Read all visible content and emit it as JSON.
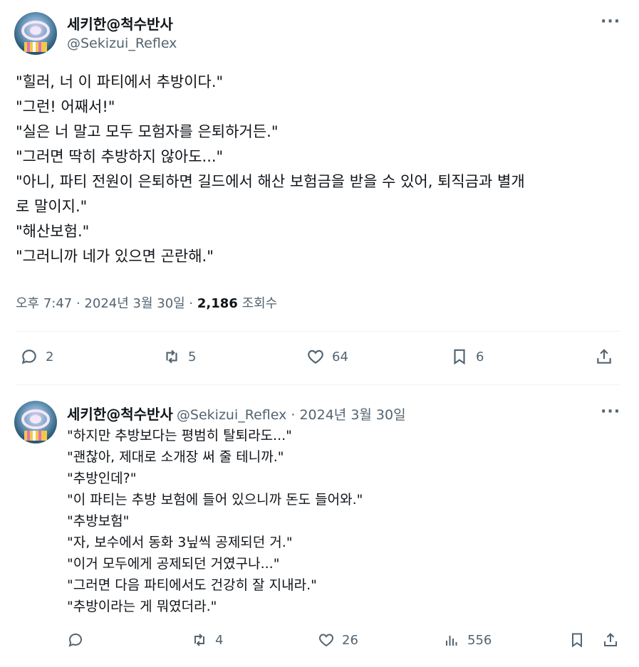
{
  "main_tweet": {
    "display_name": "세키한@척수반사",
    "handle": "@Sekizui_Reflex",
    "lines": [
      "\"힐러, 너 이 파티에서 추방이다.\"",
      "\"그런! 어째서!\"",
      "\"실은 너 말고 모두 모험자를 은퇴하거든.\"",
      "\"그러면 딱히 추방하지 않아도...\"",
      "\"아니, 파티 전원이 은퇴하면 길드에서 해산 보험금을 받을 수 있어, 퇴직금과 별개",
      "로 말이지.\"",
      "\"해산보험.\"",
      "\"그러니까 네가 있으면 곤란해.\""
    ],
    "time": "오후 7:47 · 2024년 3월 30일 · ",
    "views_count": "2,186",
    "views_label": "조회수",
    "actions": {
      "reply_count": "2",
      "retweet_count": "5",
      "like_count": "64",
      "bookmark_count": "6"
    }
  },
  "reply_tweet": {
    "display_name": "세키한@척수반사",
    "handle_date": "@Sekizui_Reflex · 2024년 3월 30일",
    "lines": [
      "\"하지만 추방보다는 평범히 탈퇴라도...\"",
      "\"괜찮아, 제대로 소개장 써 줄 테니까.\"",
      "\"추방인데?\"",
      "\"이 파티는 추방 보험에 들어 있으니까 돈도 들어와.\"",
      "\"추방보험\"",
      "\"자, 보수에서 동화 3닢씩 공제되던 거.\"",
      "\"이거 모두에게 공제되던 거였구나...\"",
      "\"그러면 다음 파티에서도 건강히 잘 지내라.\"",
      "\"추방이라는 게 뭐였더라.\""
    ],
    "actions": {
      "retweet_count": "4",
      "like_count": "26",
      "views_count": "556"
    }
  },
  "more_label": "···",
  "icons": {
    "reply": "reply-icon",
    "retweet": "retweet-icon",
    "like": "heart-icon",
    "bookmark": "bookmark-icon",
    "share": "share-icon",
    "views": "views-icon",
    "more": "more-icon"
  },
  "colors": {
    "text": "#0f1419",
    "secondary": "#536471",
    "divider": "#eff3f4"
  }
}
